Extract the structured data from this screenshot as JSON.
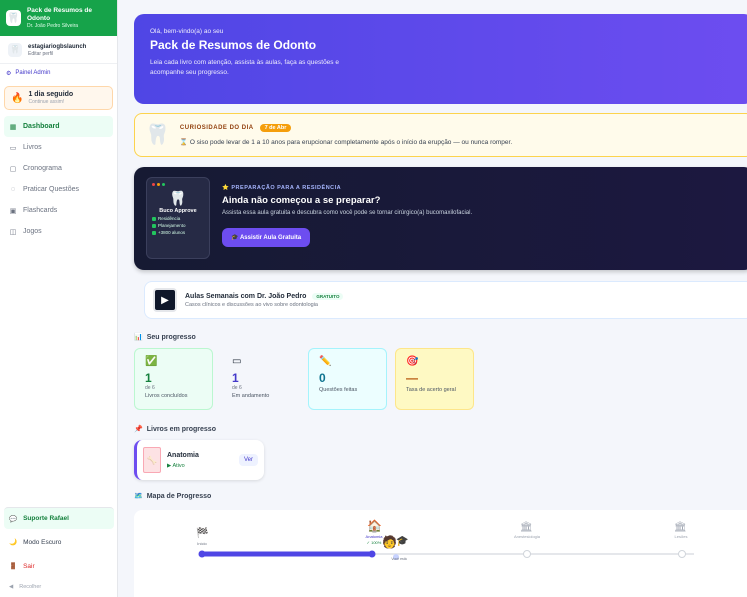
{
  "sidebar": {
    "brand_title": "Pack de Resumos de Odonto",
    "brand_subtitle": "Dr. João Pedro Silveira",
    "user_name": "estagiariogbslaunch",
    "user_edit": "Editar perfil",
    "admin_label": "Painel Admin",
    "streak_title": "1 dia seguido",
    "streak_subtitle": "Continue assim!",
    "items": [
      {
        "label": "Dashboard",
        "icon": "grid-icon"
      },
      {
        "label": "Livros",
        "icon": "book-icon"
      },
      {
        "label": "Cronograma",
        "icon": "calendar-icon"
      },
      {
        "label": "Praticar Questões",
        "icon": "question-icon"
      },
      {
        "label": "Flashcards",
        "icon": "cards-icon"
      },
      {
        "label": "Jogos",
        "icon": "gamepad-icon"
      }
    ],
    "support_label": "Suporte Rafael",
    "dark_mode_label": "Modo Escuro",
    "exit_label": "Sair",
    "collapse_label": "Recolher"
  },
  "hero": {
    "welcome": "Olá, bem-vindo(a) ao seu",
    "title": "Pack de Resumos de Odonto",
    "description": "Leia cada livro com atenção, assista às aulas, faça as questões e acompanhe seu progresso."
  },
  "curiosity": {
    "label": "CURIOSIDADE DO DIA",
    "date": "7 de Abr",
    "text": "O siso pode levar de 1 a 10 anos para erupcionar completamente após o início da erupção — ou nunca romper."
  },
  "promo": {
    "card_title": "Buco Approve",
    "card_items": [
      "Residência",
      "Planejamento",
      "+3800 alunos"
    ],
    "eyebrow": "PREPARAÇÃO PARA A RESIDÊNCIA",
    "title": "Ainda não começou a se preparar?",
    "text": "Assista essa aula gratuita e descubra como você pode se tornar cirúrgico(a) bucomaxilofacial.",
    "button": "Assistir Aula Gratuita"
  },
  "weekly": {
    "title": "Aulas Semanais com Dr. João Pedro",
    "badge": "GRATUITO",
    "subtitle": "Casos clínicos e discussões ao vivo sobre odontologia"
  },
  "progress": {
    "section_title": "Seu progresso",
    "stats": [
      {
        "value": "1",
        "sub": "de 6",
        "label": "Livros concluídos",
        "bg": "#ecfdf5",
        "border": "#bbf7d0",
        "color": "#15803d"
      },
      {
        "value": "1",
        "sub": "de 6",
        "label": "Em andamento",
        "bg": "#f4f6fb",
        "border": "#f4f6fb",
        "color": "#4338ca"
      },
      {
        "value": "0",
        "sub": "",
        "label": "Questões feitas",
        "bg": "#ecfeff",
        "border": "#a5f3fc",
        "color": "#0e7490"
      },
      {
        "value": "—",
        "sub": "",
        "label": "Taxa de acerto geral",
        "bg": "#fef9c3",
        "border": "#fde68a",
        "color": "#b45309"
      }
    ]
  },
  "books": {
    "section_title": "Livros em progresso",
    "items": [
      {
        "title": "Anatomia",
        "status": "Ativo",
        "action": "Ver"
      }
    ]
  },
  "map": {
    "section_title": "Mapa de Progresso",
    "nodes": [
      {
        "label": "Início",
        "sub": ""
      },
      {
        "label": "Anatomia",
        "sub": "✓ 100%"
      },
      {
        "label": "Anestesiologia",
        "sub": ""
      },
      {
        "label": "Lesões",
        "sub": ""
      }
    ],
    "avatar_label": "Você está"
  }
}
